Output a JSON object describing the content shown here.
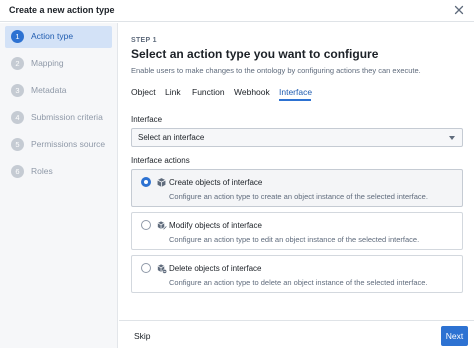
{
  "dialog": {
    "title": "Create a new action type",
    "close_icon": "close-icon"
  },
  "sidebar": {
    "steps": [
      {
        "number": "1",
        "label": "Action type",
        "active": true
      },
      {
        "number": "2",
        "label": "Mapping",
        "active": false
      },
      {
        "number": "3",
        "label": "Metadata",
        "active": false
      },
      {
        "number": "4",
        "label": "Submission criteria",
        "active": false
      },
      {
        "number": "5",
        "label": "Permissions source",
        "active": false
      },
      {
        "number": "6",
        "label": "Roles",
        "active": false
      }
    ]
  },
  "main": {
    "step_label": "STEP 1",
    "heading": "Select an action type you want to configure",
    "subtitle": "Enable users to make changes to the ontology by configuring actions they can execute.",
    "tabs": [
      {
        "label": "Object",
        "active": false
      },
      {
        "label": "Link",
        "active": false
      },
      {
        "label": "Function",
        "active": false
      },
      {
        "label": "Webhook",
        "active": false
      },
      {
        "label": "Interface",
        "active": true
      }
    ],
    "interface_field": {
      "label": "Interface",
      "value": "Select an interface"
    },
    "interface_actions": {
      "label": "Interface actions",
      "options": [
        {
          "title": "Create objects of interface",
          "description": "Configure an action type to create an object instance of the selected interface.",
          "selected": true,
          "icon": "cube-add-icon"
        },
        {
          "title": "Modify objects of interface",
          "description": "Configure an action type to edit an object instance of the selected interface.",
          "selected": false,
          "icon": "cube-edit-icon"
        },
        {
          "title": "Delete objects of interface",
          "description": "Configure an action type to delete an object instance of the selected interface.",
          "selected": false,
          "icon": "cube-remove-icon"
        }
      ]
    }
  },
  "footer": {
    "skip_label": "Skip",
    "next_label": "Next"
  },
  "colors": {
    "accent": "#2d72d2",
    "active_step_bg": "#d3e2f7",
    "sidebar_bg": "#f6f7f9"
  }
}
